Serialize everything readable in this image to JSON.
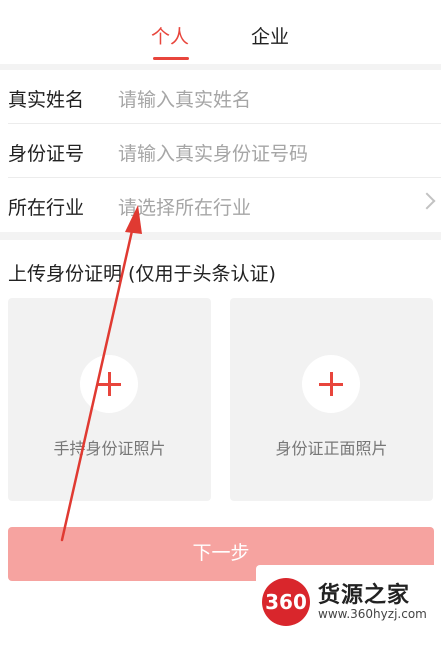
{
  "tabs": {
    "personal": "个人",
    "company": "企业"
  },
  "form": [
    {
      "label": "真实姓名",
      "placeholder": "请输入真实姓名"
    },
    {
      "label": "身份证号",
      "placeholder": "请输入真实身份证号码"
    },
    {
      "label": "所在行业",
      "placeholder": "请选择所在行业"
    }
  ],
  "upload": {
    "title": "上传身份证明 (仅用于头条认证)",
    "cards": [
      {
        "label": "手持身份证照片",
        "icon": "plus-icon"
      },
      {
        "label": "身份证正面照片",
        "icon": "plus-icon"
      }
    ]
  },
  "next_button": "下一步",
  "colors": {
    "accent": "#e8453c",
    "button_disabled": "#f6a3a0",
    "placeholder": "#a6a6a6"
  },
  "watermark": {
    "logo": "360",
    "name": "货源之家",
    "url": "www.360hyzj.com"
  }
}
